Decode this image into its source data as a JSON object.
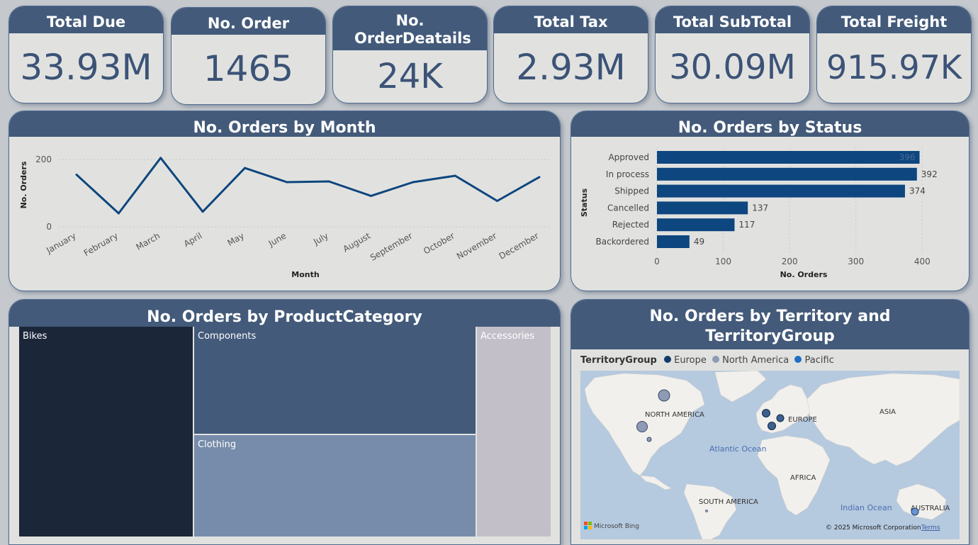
{
  "kpis": [
    {
      "label": "Total Due",
      "value": "33.93M"
    },
    {
      "label": "No. Order",
      "value": "1465"
    },
    {
      "label": "No. OrderDeatails",
      "value": "24K"
    },
    {
      "label": "Total Tax",
      "value": "2.93M"
    },
    {
      "label": "Total SubTotal",
      "value": "30.09M"
    },
    {
      "label": "Total Freight",
      "value": "915.97K"
    }
  ],
  "panels": {
    "month": {
      "title": "No. Orders by Month"
    },
    "status": {
      "title": "No. Orders by Status"
    },
    "category": {
      "title": "No. Orders by ProductCategory"
    },
    "territory": {
      "title_line1": "No. Orders by Territory and",
      "title_line2": "TerritoryGroup"
    }
  },
  "chart_data": [
    {
      "type": "line",
      "title": "No. Orders by Month",
      "xlabel": "Month",
      "ylabel": "No. Orders",
      "categories": [
        "January",
        "February",
        "March",
        "April",
        "May",
        "June",
        "July",
        "August",
        "September",
        "October",
        "November",
        "December"
      ],
      "values": [
        155,
        40,
        205,
        45,
        175,
        133,
        135,
        92,
        133,
        152,
        77,
        148
      ],
      "ylim": [
        0,
        230
      ],
      "yticks": [
        "0",
        "200"
      ],
      "color": "#0e467f"
    },
    {
      "type": "bar",
      "title": "No. Orders by Status",
      "xlabel": "No. Orders",
      "ylabel": "Status",
      "categories": [
        "Approved",
        "In process",
        "Shipped",
        "Cancelled",
        "Rejected",
        "Backordered"
      ],
      "values": [
        396,
        392,
        374,
        137,
        117,
        49
      ],
      "data_labels": [
        "396",
        "392",
        "374",
        "137",
        "117",
        "49"
      ],
      "xlim": [
        0,
        420
      ],
      "xticks": [
        "0",
        "100",
        "200",
        "300",
        "400"
      ],
      "color": "#0e467f"
    },
    {
      "type": "treemap",
      "title": "No. Orders by ProductCategory",
      "categories": [
        "Bikes",
        "Components",
        "Clothing",
        "Accessories"
      ],
      "colors": [
        "#1b2639",
        "#435a7a",
        "#778caa",
        "#c3bfc9"
      ]
    }
  ],
  "map": {
    "legend_title": "TerritoryGroup",
    "legend": [
      {
        "name": "Europe",
        "color": "#133b6a"
      },
      {
        "name": "North America",
        "color": "#8d9bb6"
      },
      {
        "name": "Pacific",
        "color": "#1f6fc4"
      }
    ],
    "labels": {
      "north_america": "NORTH AMERICA",
      "europe": "EUROPE",
      "asia": "ASIA",
      "atlantic": "Atlantic Ocean",
      "africa": "AFRICA",
      "south_america": "SOUTH AMERICA",
      "indian": "Indian Ocean",
      "australia": "AUSTRALIA"
    },
    "bing_logo": "Microsoft Bing",
    "copyright": "© 2025 Microsoft Corporation",
    "terms": "Terms"
  }
}
